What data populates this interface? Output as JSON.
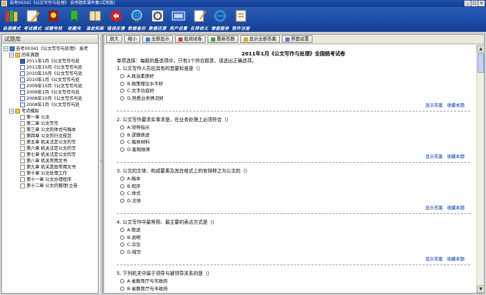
{
  "window": {
    "title": "自考00341《公文写作与处理》 自考题库课件集(试用版)",
    "buttons": [
      "_",
      "□",
      "×"
    ]
  },
  "toolbar": {
    "items": [
      {
        "label": "自测模式",
        "icon": "books-icon"
      },
      {
        "label": "考试模式",
        "icon": "pencil-icon"
      },
      {
        "label": "试题夸技",
        "icon": "trophy-icon"
      },
      {
        "label": "收藏夹",
        "icon": "folder-icon"
      },
      {
        "label": "温故知新",
        "icon": "book-icon"
      },
      {
        "label": "错误反馈",
        "icon": "error-icon"
      },
      {
        "label": "数据备份",
        "icon": "globe-icon"
      },
      {
        "label": "数据还原",
        "icon": "refresh-icon"
      },
      {
        "label": "用户设置",
        "icon": "user-icon"
      },
      {
        "label": "名师讲义",
        "icon": "notes-icon"
      },
      {
        "label": "增值服务",
        "icon": "ie-icon"
      },
      {
        "label": "软件注册",
        "icon": "register-icon"
      }
    ]
  },
  "left": {
    "header": "试题库",
    "root": "自考00341《公文写作与处理》 易考",
    "group1": "历年真题",
    "papers": [
      "2011年1月《公文写作与处",
      "2011年10月《公文写作与处",
      "2010年10月《公文写作与处",
      "2010年1月《公文写作与处",
      "2009年10月《公文写作与处",
      "2009年1月《公文写作与处",
      "2008年10月《公文写作与处",
      "2008年1月《公文写作与处"
    ],
    "group2": "考点模拟",
    "chapters": [
      "第一章  公文",
      "第二章  公文写作",
      "第三章  公文的体式与稿本",
      "第四章  公文的行文规范",
      "第五章  机关法定公文的写",
      "第六章  机关法定公文的写",
      "第七章  机关法定公文的写",
      "第八章  机关常用文书",
      "第九章  机关其他常用文书",
      "第十章  公文处理工作",
      "第十一章  公文办理程序",
      "第十二章  公文的整理(立卷"
    ]
  },
  "actions": {
    "buttons": [
      "放大",
      "缩小",
      "全部显示",
      "批阅试卷",
      "重新答题",
      "显示全部答案",
      "界面设置"
    ]
  },
  "paper": {
    "title": "2011年1月《公文写作与处理》全国统考试卷",
    "instruction": "单项选择：每题的备选项中，只有1个符合题意，请选出正确选项。",
    "show_answer": "显示答案",
    "favorite": "收藏本题",
    "questions": [
      {
        "text": "1. 公文写作人员应具有的首要标准是（）",
        "options": [
          "A.政治素质好",
          "B.政策理论水平好",
          "C.文字功底好",
          "D.熟悉业务情况好"
        ]
      },
      {
        "text": "2. 公文写作要求实事求是，在业务处理上必须符合（）",
        "options": [
          "A.领导指示",
          "B.逻辑表述",
          "C.载体材料",
          "D.客观规律"
        ]
      },
      {
        "text": "3. 公文的文体、构成要素及其在格式上的安排称之为公文的（）",
        "options": [
          "A.稿本",
          "B.程序",
          "C.体式",
          "D.文体"
        ]
      },
      {
        "text": "4. 公文写作中最常用、最主要的表达方式是（）",
        "options": [
          "A.叙述",
          "B.说明",
          "C.议论",
          "D.描写"
        ]
      },
      {
        "text": "5. 下列机关中属于领导与被领导关系的是（）",
        "options": [
          "A.省教育厅与市政府",
          "B.省教育厅与市政府"
        ]
      }
    ]
  }
}
